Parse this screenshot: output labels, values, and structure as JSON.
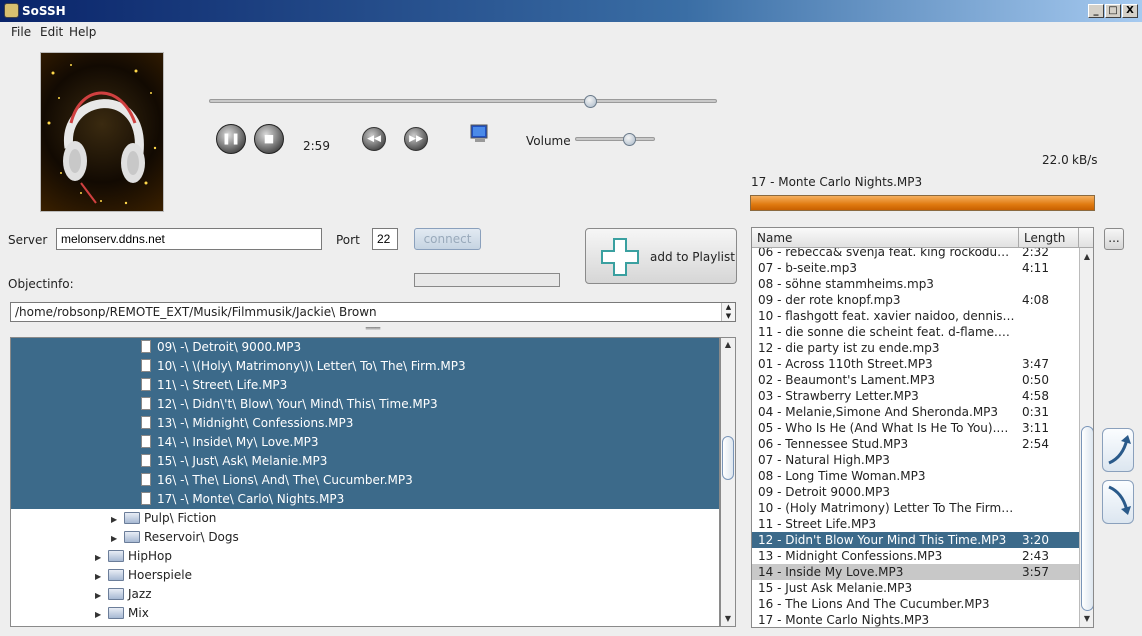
{
  "window": {
    "title": "SoSSH",
    "min": "_",
    "max": "□",
    "close": "X"
  },
  "menu": [
    "File",
    "Edit",
    "Help"
  ],
  "player": {
    "time": "2:59",
    "volume_label": "Volume",
    "seek_fraction": 0.75,
    "volume_fraction": 0.68,
    "speed_value": "22.0",
    "speed_unit": "kB/s",
    "now_playing": "17 - Monte Carlo Nights.MP3",
    "progress_fraction": 1.0
  },
  "connection": {
    "server_label": "Server",
    "server_value": "melonserv.ddns.net",
    "port_label": "Port",
    "port_value": "22",
    "connect_label": "connect",
    "objectinfo_label": "Objectinfo:",
    "add_playlist_label": "add to Playlist"
  },
  "path": "/home/robsonp/REMOTE_EXT/Musik/Filmmusik/Jackie\\ Brown",
  "tree": [
    {
      "label": "09\\ -\\ Detroit\\ 9000.MP3",
      "type": "file",
      "sel": true,
      "indent": 2
    },
    {
      "label": "10\\ -\\ \\(Holy\\ Matrimony\\)\\ Letter\\ To\\ The\\ Firm.MP3",
      "type": "file",
      "sel": true,
      "indent": 2
    },
    {
      "label": "11\\ -\\ Street\\ Life.MP3",
      "type": "file",
      "sel": true,
      "indent": 2
    },
    {
      "label": "12\\ -\\ Didn\\'t\\ Blow\\ Your\\ Mind\\ This\\ Time.MP3",
      "type": "file",
      "sel": true,
      "indent": 2
    },
    {
      "label": "13\\ -\\ Midnight\\ Confessions.MP3",
      "type": "file",
      "sel": true,
      "indent": 2
    },
    {
      "label": "14\\ -\\ Inside\\ My\\ Love.MP3",
      "type": "file",
      "sel": true,
      "indent": 2
    },
    {
      "label": "15\\ -\\ Just\\ Ask\\ Melanie.MP3",
      "type": "file",
      "sel": true,
      "indent": 2
    },
    {
      "label": "16\\ -\\ The\\ Lions\\ And\\ The\\ Cucumber.MP3",
      "type": "file",
      "sel": true,
      "indent": 2
    },
    {
      "label": "17\\ -\\ Monte\\ Carlo\\ Nights.MP3",
      "type": "file",
      "sel": true,
      "indent": 2
    },
    {
      "label": "Pulp\\ Fiction",
      "type": "folder",
      "sel": false,
      "indent": 1
    },
    {
      "label": "Reservoir\\ Dogs",
      "type": "folder",
      "sel": false,
      "indent": 1
    },
    {
      "label": "HipHop",
      "type": "folder",
      "sel": false,
      "indent": 0
    },
    {
      "label": "Hoerspiele",
      "type": "folder",
      "sel": false,
      "indent": 0
    },
    {
      "label": "Jazz",
      "type": "folder",
      "sel": false,
      "indent": 0
    },
    {
      "label": "Mix",
      "type": "folder",
      "sel": false,
      "indent": 0
    }
  ],
  "playlist": {
    "col_name": "Name",
    "col_length": "Length",
    "more_label": "...",
    "rows": [
      {
        "name": "06 - rebecca& svenja feat. king rockodub sch...",
        "length": "2:32",
        "state": ""
      },
      {
        "name": "07 - b-seite.mp3",
        "length": "4:11",
        "state": ""
      },
      {
        "name": "08 - söhne stammheims.mp3",
        "length": "",
        "state": ""
      },
      {
        "name": "09 - der rote knopf.mp3",
        "length": "4:08",
        "state": ""
      },
      {
        "name": "10 - flashgott feat. xavier naidoo, dennis dub...",
        "length": "",
        "state": ""
      },
      {
        "name": "11 - die sonne die scheint feat. d-flame.mp3",
        "length": "",
        "state": ""
      },
      {
        "name": "12 - die party ist zu ende.mp3",
        "length": "",
        "state": ""
      },
      {
        "name": "01 - Across 110th Street.MP3",
        "length": "3:47",
        "state": ""
      },
      {
        "name": "02 - Beaumont's Lament.MP3",
        "length": "0:50",
        "state": ""
      },
      {
        "name": "03 - Strawberry Letter.MP3",
        "length": "4:58",
        "state": ""
      },
      {
        "name": "04 - Melanie,Simone And Sheronda.MP3",
        "length": "0:31",
        "state": ""
      },
      {
        "name": "05 - Who Is He (And What Is He To You).MP3",
        "length": "3:11",
        "state": ""
      },
      {
        "name": "06 - Tennessee Stud.MP3",
        "length": "2:54",
        "state": ""
      },
      {
        "name": "07 - Natural High.MP3",
        "length": "",
        "state": ""
      },
      {
        "name": "08 - Long Time Woman.MP3",
        "length": "",
        "state": ""
      },
      {
        "name": "09 - Detroit 9000.MP3",
        "length": "",
        "state": ""
      },
      {
        "name": "10 - (Holy Matrimony) Letter To The Firm.MP3",
        "length": "",
        "state": ""
      },
      {
        "name": "11 - Street Life.MP3",
        "length": "",
        "state": ""
      },
      {
        "name": "12 - Didn't Blow Your Mind This Time.MP3",
        "length": "3:20",
        "state": "sel"
      },
      {
        "name": "13 - Midnight Confessions.MP3",
        "length": "2:43",
        "state": ""
      },
      {
        "name": "14 - Inside My Love.MP3",
        "length": "3:57",
        "state": "hl"
      },
      {
        "name": "15 - Just Ask Melanie.MP3",
        "length": "",
        "state": ""
      },
      {
        "name": "16 - The Lions And The Cucumber.MP3",
        "length": "",
        "state": ""
      },
      {
        "name": "17 - Monte Carlo Nights.MP3",
        "length": "",
        "state": ""
      }
    ]
  },
  "icons": {
    "pause": "pause-icon",
    "stop": "stop-icon",
    "prev": "previous-icon",
    "next": "next-icon",
    "monitor": "monitor-icon",
    "add": "plus-icon",
    "moveup": "move-up-icon",
    "movedown": "move-down-icon"
  }
}
